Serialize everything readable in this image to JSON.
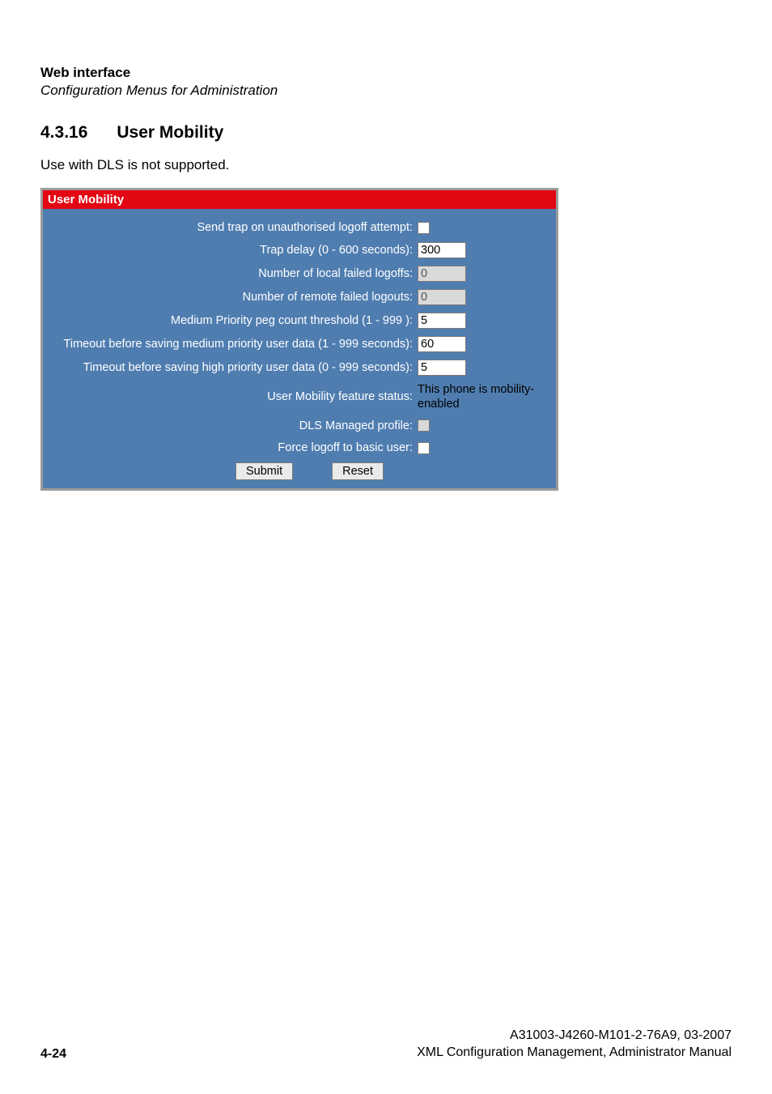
{
  "header": {
    "title": "Web interface",
    "subtitle": "Configuration Menus for Administration"
  },
  "section": {
    "number": "4.3.16",
    "title": "User Mobility",
    "note": "Use with DLS is not supported."
  },
  "panel": {
    "title": "User Mobility",
    "fields": {
      "send_trap": {
        "label": "Send trap on unauthorised logoff attempt:"
      },
      "trap_delay": {
        "label": "Trap delay (0 - 600 seconds):",
        "value": "300"
      },
      "local_failed": {
        "label": "Number of local failed logoffs:",
        "value": "0"
      },
      "remote_failed": {
        "label": "Number of remote failed logouts:",
        "value": "0"
      },
      "peg_threshold": {
        "label": "Medium Priority peg count threshold (1 - 999 ):",
        "value": "5"
      },
      "timeout_medium": {
        "label": "Timeout before saving medium priority user data (1 - 999 seconds):",
        "value": "60"
      },
      "timeout_high": {
        "label": "Timeout before saving high priority user data (0 - 999 seconds):",
        "value": "5"
      },
      "feature_status": {
        "label": "User Mobility feature status:",
        "value": "This phone is mobility-enabled"
      },
      "dls_profile": {
        "label": "DLS Managed profile:"
      },
      "force_logoff": {
        "label": "Force logoff to basic user:"
      }
    },
    "buttons": {
      "submit": "Submit",
      "reset": "Reset"
    }
  },
  "footer": {
    "page": "4-24",
    "doc_id": "A31003-J4260-M101-2-76A9, 03-2007",
    "doc_title": "XML Configuration Management, Administrator Manual"
  }
}
